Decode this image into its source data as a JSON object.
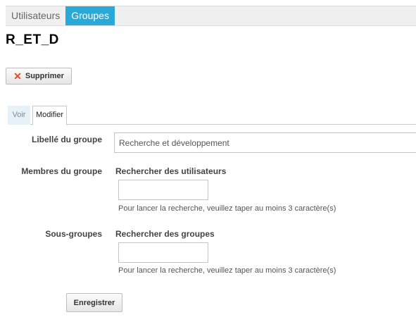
{
  "top_tabs": [
    {
      "label": "Utilisateurs",
      "active": false
    },
    {
      "label": "Groupes",
      "active": true
    }
  ],
  "page_title": "R_ET_D",
  "delete_button": {
    "label": "Supprimer",
    "icon": "x-icon"
  },
  "sub_tabs": [
    {
      "label": "Voir",
      "active": false
    },
    {
      "label": "Modifier",
      "active": true
    }
  ],
  "form": {
    "libelle": {
      "label": "Libellé du groupe",
      "value": "Recherche et développement"
    },
    "membres": {
      "label": "Membres du groupe",
      "search_title": "Rechercher des utilisateurs",
      "value": "",
      "hint": "Pour lancer la recherche, veuillez taper au moins 3 caractère(s)"
    },
    "sous_groupes": {
      "label": "Sous-groupes",
      "search_title": "Rechercher des groupes",
      "value": "",
      "hint": "Pour lancer la recherche, veuillez taper au moins 3 caractère(s)"
    },
    "save_label": "Enregistrer"
  },
  "colors": {
    "accent": "#29a9d8",
    "delete_icon": "#e14b26"
  }
}
